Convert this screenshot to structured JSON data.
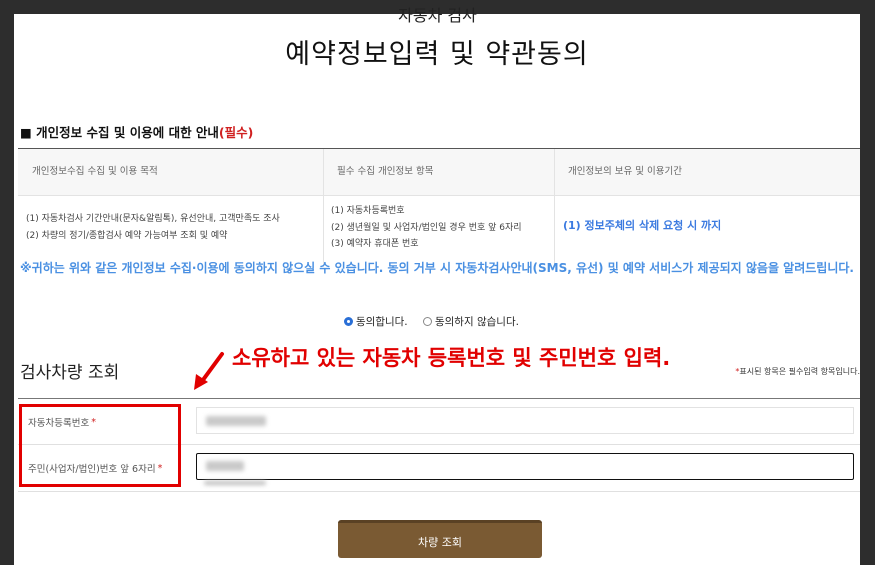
{
  "page": {
    "subtitle": "자동차 검사",
    "title": "예약정보입력 및 약관동의"
  },
  "privacy": {
    "section_title": "■ 개인정보 수집 및 이용에 대한 안내",
    "section_required": "(필수)",
    "headers": [
      "개인정보수집 수집 및 이용 목적",
      "필수 수집 개인정보 항목",
      "개인정보의 보유 및 이용기간"
    ],
    "purposes": [
      "(1) 자동차검사 기간안내(문자&알림톡), 유선안내, 고객만족도 조사",
      "(2) 차량의 정기/종합검사 예약 가능여부 조회 및 예약"
    ],
    "items": [
      "(1) 자동차등록번호",
      "(2) 생년월일 및 사업자/법인일 경우 번호 앞 6자리",
      "(3) 예약자 휴대폰 번호"
    ],
    "retention": "(1) 정보주체의 삭제 요청 시 까지",
    "notice": "※귀하는 위와 같은 개인정보 수집·이용에 동의하지 않으실 수 있습니다. 동의 거부 시 자동차검사안내(SMS, 유선) 및 예약 서비스가 제공되지 않음을 알려드립니다.",
    "agree_label": "동의합니다.",
    "disagree_label": "동의하지 않습니다."
  },
  "annotation": {
    "text": "소유하고 있는 자동차 등록번호 및 주민번호 입력."
  },
  "vehicle": {
    "section_title": "검사차량 조회",
    "required_note_star": "*",
    "required_note": "표시된 항목은 필수입력 항목입니다.",
    "reg_label": "자동차등록번호",
    "id_label": "주민(사업자/법인)번호 앞 6자리",
    "star": "*"
  },
  "submit_label": "차량 조회",
  "colors": {
    "required_red": "#d02020",
    "notice_blue": "#4a90e2",
    "button_brown": "#7a5a33",
    "annotation_red": "#e10000"
  }
}
